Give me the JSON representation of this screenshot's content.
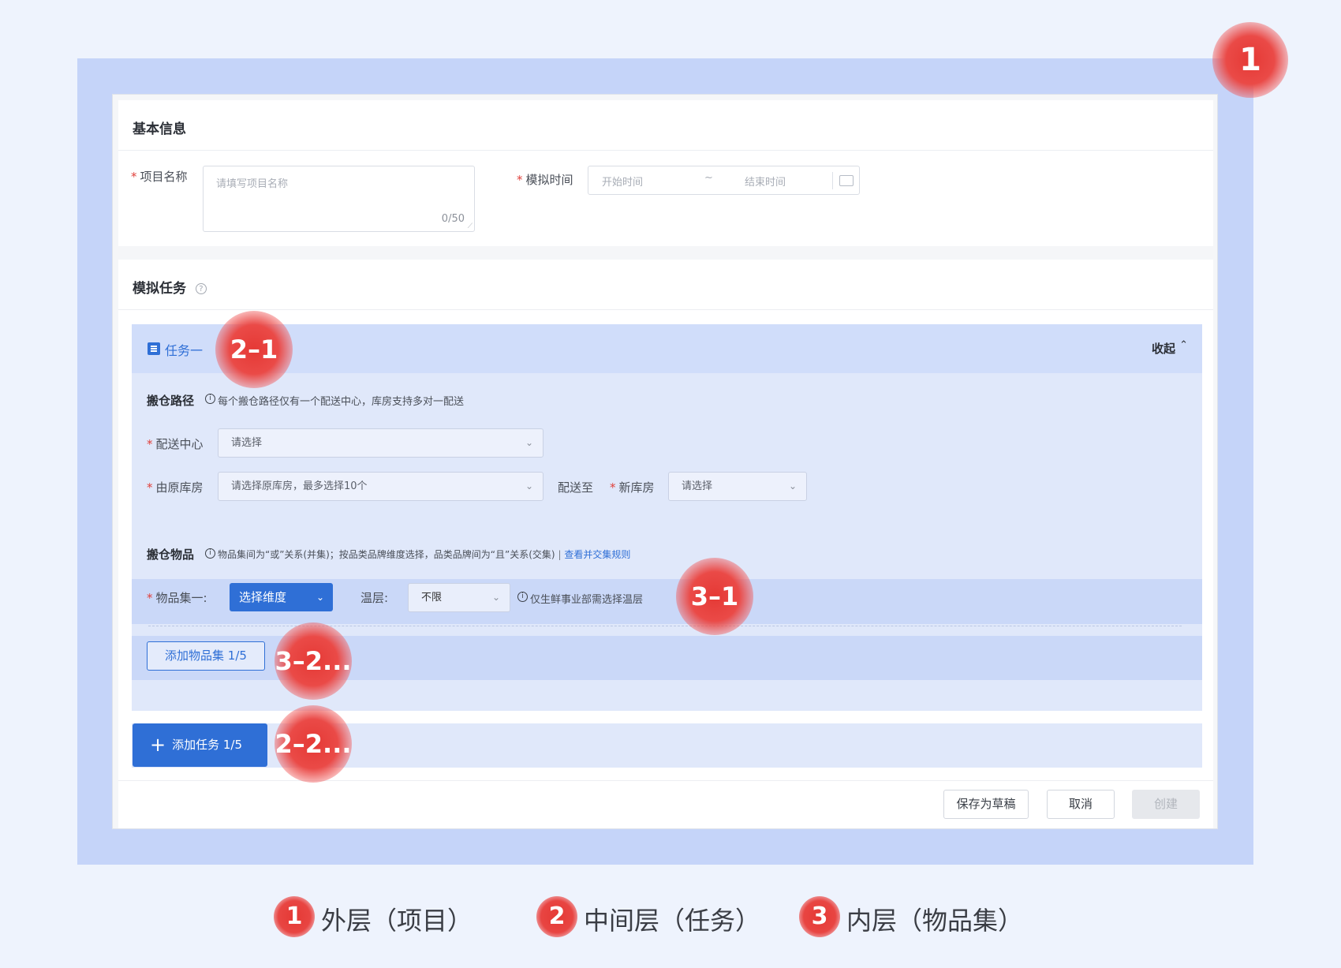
{
  "basic": {
    "title": "基本信息",
    "project_name_label": "项目名称",
    "project_name_placeholder": "请填写项目名称",
    "project_name_counter": "0/50",
    "sim_time_label": "模拟时间",
    "start_placeholder": "开始时间",
    "range_separator": "~",
    "end_placeholder": "结束时间"
  },
  "sim": {
    "title": "模拟任务",
    "task": {
      "title": "任务一",
      "collapse_label": "收起",
      "route_label": "搬仓路径",
      "route_hint": "每个搬仓路径仅有一个配送中心，库房支持多对一配送",
      "dc_label": "配送中心",
      "dc_placeholder": "请选择",
      "from_label": "由原库房",
      "from_placeholder": "请选择原库房，最多选择10个",
      "to_label": "配送至",
      "new_wh_label": "新库房",
      "new_wh_placeholder": "请选择",
      "goods_label": "搬仓物品",
      "goods_hint": "物品集间为“或”关系(并集)；按品类品牌维度选择，品类品牌间为“且”关系(交集)",
      "goods_divider": "|",
      "rule_link": "查看并交集规则",
      "set_label": "物品集一:",
      "dimension_button": "选择维度",
      "temp_label": "温层:",
      "temp_value": "不限",
      "temp_hint": "仅生鲜事业部需选择温层",
      "add_set_button": "添加物品集 1/5"
    },
    "add_task_button": "添加任务 1/5"
  },
  "footer": {
    "save_draft": "保存为草稿",
    "cancel": "取消",
    "create": "创建"
  },
  "annotations": {
    "m1": "1",
    "m2_1": "2–1",
    "m3_1": "3–1",
    "m3_2": "3–2...",
    "m2_2": "2–2..."
  },
  "legend": [
    {
      "num": "1",
      "text": "外层（项目）"
    },
    {
      "num": "2",
      "text": "中间层（任务）"
    },
    {
      "num": "3",
      "text": "内层（物品集）"
    }
  ],
  "colors": {
    "primary": "#2f6fd6",
    "marker": "#e53935",
    "outer_bg": "#c5d4f9",
    "task_bg": "#e0e8fa"
  }
}
